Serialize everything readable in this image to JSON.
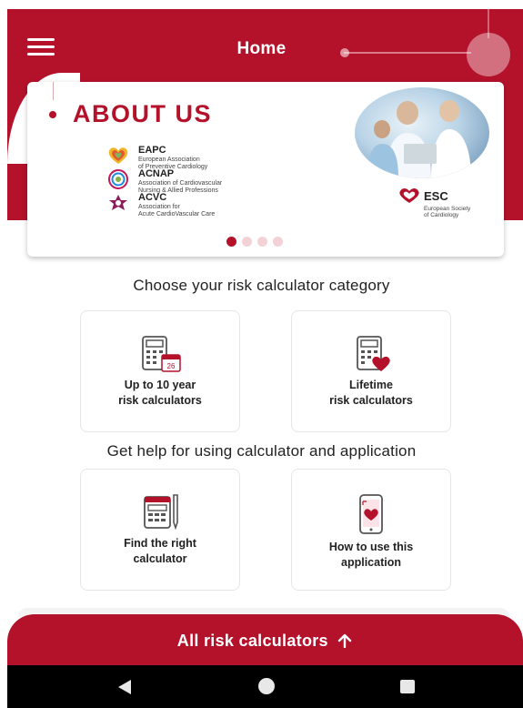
{
  "header": {
    "title": "Home",
    "menu_icon": "hamburger-menu-icon",
    "color": "#b4122b"
  },
  "banner": {
    "title": "ABOUT US",
    "organizations": [
      {
        "abbr": "EAPC",
        "full1": "European Association",
        "full2": "of Preventive Cardiology"
      },
      {
        "abbr": "ACNAP",
        "full1": "Association of Cardiovascular",
        "full2": "Nursing & Allied Professions"
      },
      {
        "abbr": "ACVC",
        "full1": "Association for",
        "full2": "Acute CardioVascular Care"
      }
    ],
    "esc": {
      "abbr": "ESC",
      "full1": "European Society",
      "full2": "of Cardiology"
    },
    "carousel_pages": 4,
    "carousel_active": 1
  },
  "sections": {
    "choose_title": "Choose your risk calculator category",
    "help_title": "Get help for using calculator and application"
  },
  "tiles": {
    "ten_year": {
      "line1": "Up to 10 year",
      "line2": "risk calculators",
      "icon": "calculator-calendar-icon",
      "calendar_day": "26"
    },
    "lifetime": {
      "line1": "Lifetime",
      "line2": "risk calculators",
      "icon": "calculator-heart-icon"
    },
    "find": {
      "line1": "Find the right",
      "line2": "calculator",
      "icon": "calculator-pen-icon"
    },
    "howto": {
      "line1": "How to use this",
      "line2": "application",
      "icon": "phone-heart-icon"
    }
  },
  "cta": {
    "label": "All risk calculators",
    "icon": "arrow-up-icon"
  },
  "android_nav": {
    "back": "back-icon",
    "home": "home-icon",
    "recent": "recent-apps-icon"
  }
}
